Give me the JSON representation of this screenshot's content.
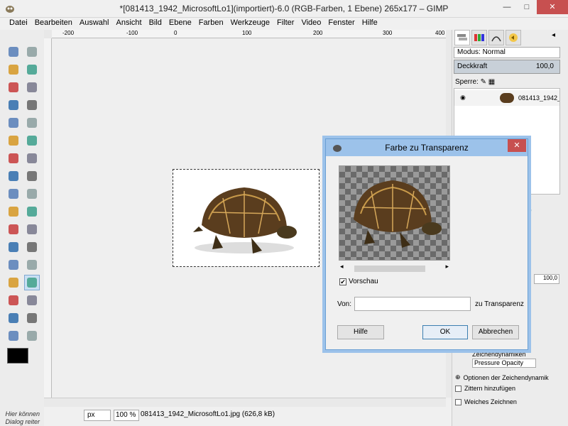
{
  "window": {
    "title": "*[081413_1942_MicrosoftLo1](importiert)-6.0 (RGB-Farben, 1 Ebene) 265x177 – GIMP",
    "minimize": "—",
    "maximize": "□",
    "close": "✕"
  },
  "menu": [
    "Datei",
    "Bearbeiten",
    "Auswahl",
    "Ansicht",
    "Bild",
    "Ebene",
    "Farben",
    "Werkzeuge",
    "Filter",
    "Video",
    "Fenster",
    "Hilfe"
  ],
  "ruler": {
    "h_ticks": [
      "-200",
      "-100",
      "0",
      "100",
      "200",
      "300",
      "400"
    ],
    "v_ticks": [
      "100",
      "0",
      "100",
      "200",
      "300"
    ]
  },
  "toolbox": {
    "hint": "Hier können Dialog reiter abgelegt werde.",
    "tools": [
      "rect-select",
      "ellipse-select",
      "free-select",
      "fuzzy-select",
      "color-select",
      "scissors",
      "foreground-select",
      "paths",
      "color-picker",
      "zoom",
      "measure",
      "move",
      "align",
      "crop",
      "rotate",
      "scale",
      "shear",
      "perspective",
      "flip",
      "cage",
      "text",
      "bucket-fill",
      "blend",
      "pencil",
      "paintbrush",
      "eraser",
      "airbrush",
      "ink",
      "clone",
      "heal",
      "perspective-clone",
      "blur",
      "smudge",
      "dodge-burn"
    ]
  },
  "status": {
    "unit": "px",
    "zoom": "100 %",
    "file_info": "081413_1942_MicrosoftLo1.jpg (626,8 kB)"
  },
  "layers": {
    "mode_label": "Modus:",
    "mode_value": "Normal",
    "opacity_label": "Deckkraft",
    "opacity_value": "100,0",
    "lock_label": "Sperre:",
    "layer_name": "081413_1942_Mic"
  },
  "tool_options": {
    "opacity_value": "100,0",
    "dynamics_label": "Zeichendynamiken",
    "dynamics_value": "Pressure Opacity",
    "dynamics_options": "Optionen der Zeichendynamik",
    "jitter": "Zittern hinzufügen",
    "smooth": "Weiches Zeichnen"
  },
  "dialog": {
    "title": "Farbe zu Transparenz",
    "preview_label": "Vorschau",
    "preview_checked": "✔",
    "from_label": "Von:",
    "to_label": "zu Transparenz",
    "help_button": "Hilfe",
    "ok_button": "OK",
    "cancel_button": "Abbrechen",
    "close": "✕"
  },
  "colors": {
    "dialog_frame": "#9cc2ea",
    "close_red": "#c75050",
    "selection_blue": "#c9dff3"
  }
}
